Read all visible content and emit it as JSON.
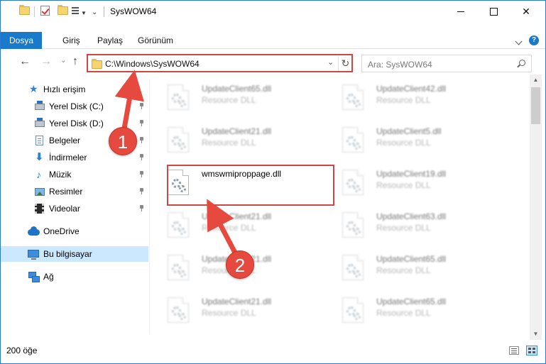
{
  "window": {
    "title": "SysWOW64",
    "close_glyph": "✕"
  },
  "ribbon": {
    "tabs": [
      "Dosya",
      "Giriş",
      "Paylaş",
      "Görünüm"
    ],
    "help_glyph": "?"
  },
  "nav": {
    "back_glyph": "←",
    "forward_glyph": "→",
    "recent_glyph": "⌄",
    "up_glyph": "↑",
    "address": "C:\\Windows\\SysWOW64",
    "dropdown_glyph": "⌄",
    "refresh_glyph": "↻",
    "search_placeholder": "Ara: SysWOW64"
  },
  "sidebar": {
    "items": [
      {
        "label": "Hızlı erişim",
        "icon": "star-icon"
      },
      {
        "label": "Yerel Disk (C:)",
        "icon": "disk-icon"
      },
      {
        "label": "Yerel Disk (D:)",
        "icon": "disk-icon"
      },
      {
        "label": "Belgeler",
        "icon": "documents-icon"
      },
      {
        "label": "İndirmeler",
        "icon": "download-icon"
      },
      {
        "label": "Müzik",
        "icon": "music-icon"
      },
      {
        "label": "Resimler",
        "icon": "pictures-icon"
      },
      {
        "label": "Videolar",
        "icon": "videos-icon"
      },
      {
        "label": "OneDrive",
        "icon": "cloud-icon"
      },
      {
        "label": "Bu bilgisayar",
        "icon": "computer-icon"
      },
      {
        "label": "Ağ",
        "icon": "network-icon"
      }
    ],
    "star_glyph": "★",
    "download_glyph": "⬇",
    "music_glyph": "♪"
  },
  "files": [
    {
      "name": "UpdateClient65.dll",
      "type": "Resource DLL"
    },
    {
      "name": "UpdateClient42.dll",
      "type": "Resource DLL"
    },
    {
      "name": "UpdateClient21.dll",
      "type": "Resource DLL"
    },
    {
      "name": "UpdateClient5.dll",
      "type": "Resource DLL"
    },
    {
      "name": "wmswmiproppage.dll",
      "type": ""
    },
    {
      "name": "UpdateClient19.dll",
      "type": "Resource DLL"
    },
    {
      "name": "UpdateClient21.dll",
      "type": "Resource DLL"
    },
    {
      "name": "UpdateClient63.dll",
      "type": "Resource DLL"
    },
    {
      "name": "UpdateClient21.dll",
      "type": "Resource DLL"
    },
    {
      "name": "UpdateClient65.dll",
      "type": "Resource DLL"
    },
    {
      "name": "UpdateClient21.dll",
      "type": "Resource DLL"
    },
    {
      "name": "UpdateClient65.dll",
      "type": "Resource DLL"
    }
  ],
  "scroll": {
    "up_glyph": "▲",
    "down_glyph": "▼"
  },
  "status": {
    "item_count": "200 öğe"
  },
  "annotations": {
    "marker_1": "1",
    "marker_2": "2",
    "color": "#e64a3f"
  }
}
